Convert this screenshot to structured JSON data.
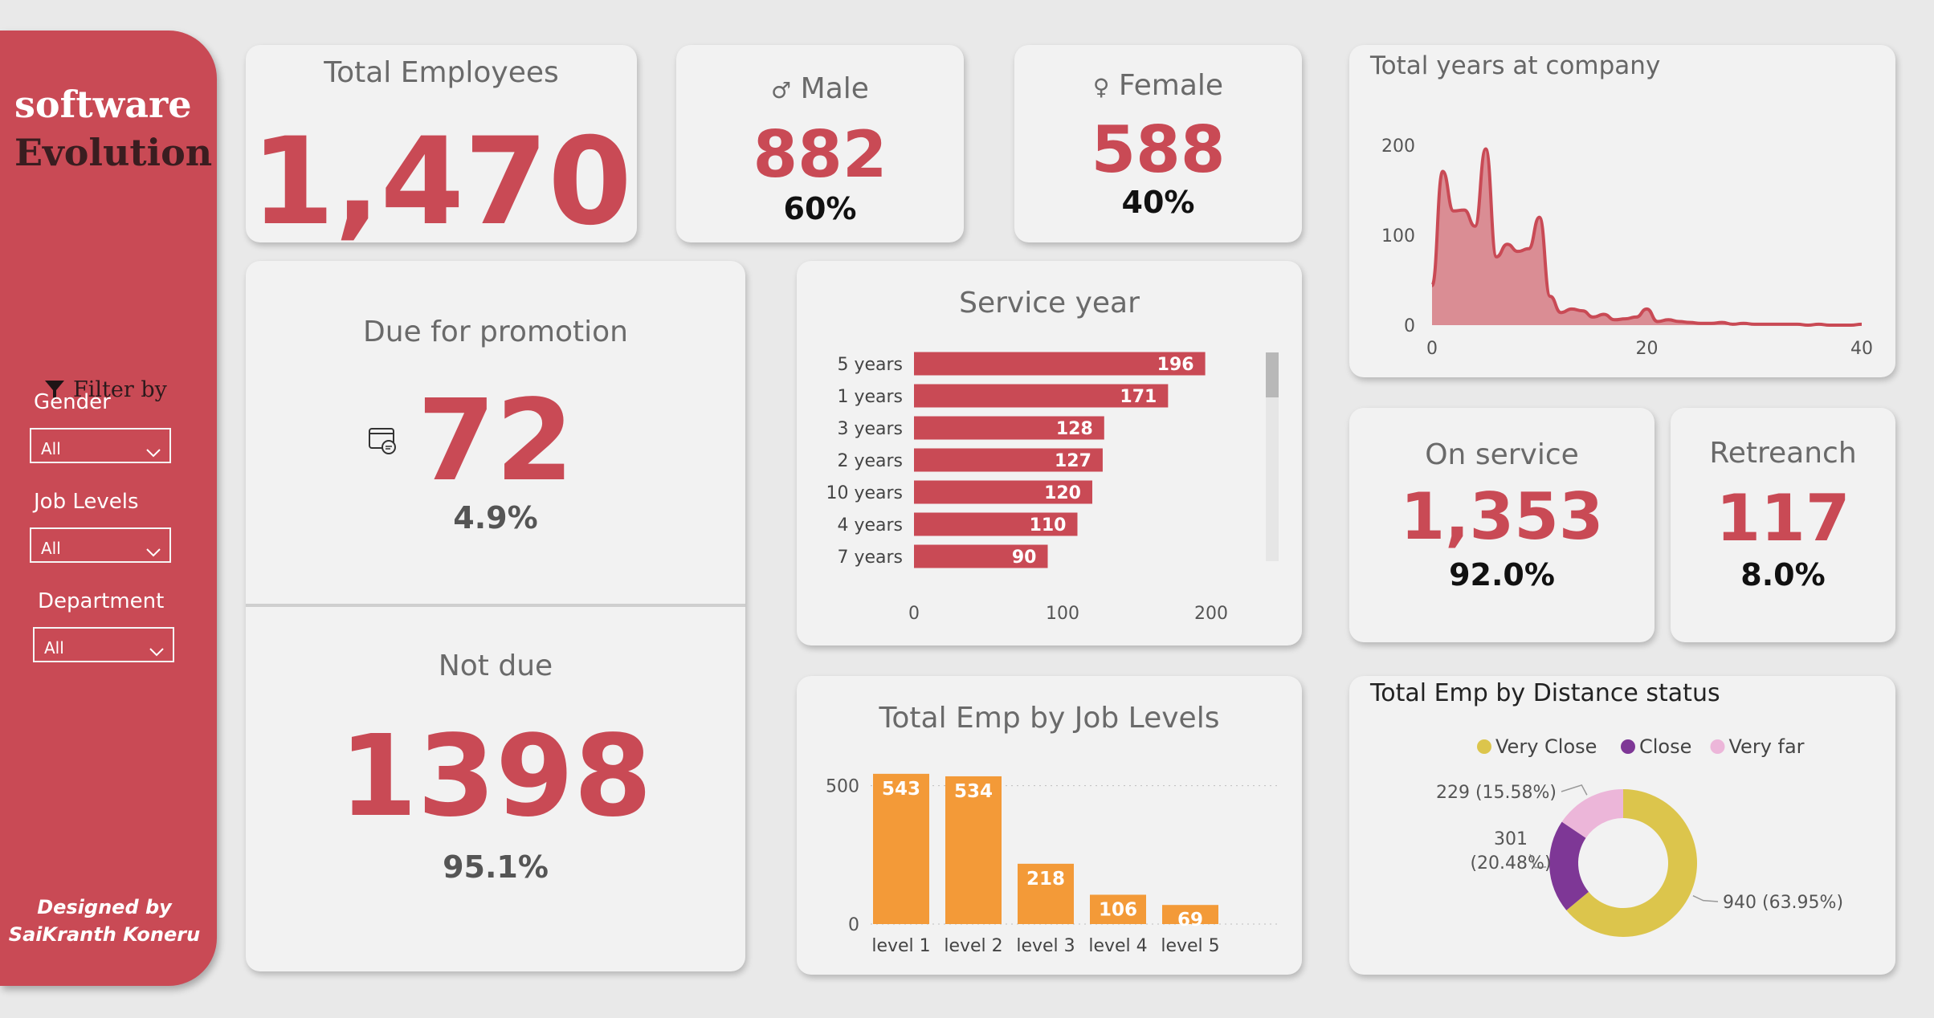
{
  "sidebar": {
    "brand_line1": "software",
    "brand_line2": "Evolution",
    "filter_by": "Filter by",
    "filters": [
      {
        "label": "Gender",
        "value": "All"
      },
      {
        "label": "Job Levels",
        "value": "All"
      },
      {
        "label": "Department",
        "value": "All"
      }
    ],
    "credit_line1": "Designed by",
    "credit_line2": "SaiKranth Koneru"
  },
  "kpis": {
    "total_employees": {
      "title": "Total Employees",
      "value": "1,470"
    },
    "male": {
      "title": "Male",
      "value": "882",
      "pct": "60%"
    },
    "female": {
      "title": "Female",
      "value": "588",
      "pct": "40%"
    },
    "due": {
      "title": "Due for promotion",
      "value": "72",
      "pct": "4.9%"
    },
    "not_due": {
      "title": "Not due",
      "value": "1398",
      "pct": "95.1%"
    },
    "on_service": {
      "title": "On service",
      "value": "1,353",
      "pct": "92.0%"
    },
    "retrench": {
      "title": "Retreanch",
      "value": "117",
      "pct": "8.0%"
    }
  },
  "colors": {
    "accent": "#c94a55",
    "orange": "#f39a38",
    "very_close": "#dcc54c",
    "close": "#7e3796",
    "very_far": "#ecb6d9"
  },
  "chart_data": [
    {
      "type": "area",
      "title": "Total years at company",
      "x": [
        0,
        1,
        2,
        3,
        4,
        5,
        6,
        7,
        8,
        9,
        10,
        11,
        12,
        13,
        14,
        15,
        16,
        17,
        18,
        19,
        20,
        21,
        22,
        23,
        24,
        25,
        26,
        27,
        28,
        29,
        30,
        31,
        32,
        33,
        34,
        35,
        36,
        37,
        38,
        39,
        40
      ],
      "values": [
        44,
        171,
        127,
        128,
        110,
        196,
        76,
        90,
        82,
        85,
        120,
        32,
        14,
        18,
        16,
        9,
        12,
        6,
        7,
        9,
        18,
        4,
        6,
        4,
        3,
        2,
        2,
        3,
        1,
        2,
        1,
        1,
        1,
        1,
        1,
        0,
        1,
        0,
        0,
        0,
        1
      ],
      "ylim": [
        0,
        200
      ],
      "yticks": [
        0,
        100,
        200
      ],
      "xlim": [
        0,
        40
      ],
      "xticks": [
        0,
        20,
        40
      ]
    },
    {
      "type": "bar",
      "orientation": "horizontal",
      "title": "Service year",
      "categories": [
        "5 years",
        "1 years",
        "3 years",
        "2 years",
        "10 years",
        "4 years",
        "7 years"
      ],
      "values": [
        196,
        171,
        128,
        127,
        120,
        110,
        90
      ],
      "xlim": [
        0,
        200
      ],
      "xticks": [
        0,
        100,
        200
      ]
    },
    {
      "type": "bar",
      "title": "Total Emp by Job Levels",
      "categories": [
        "level 1",
        "level 2",
        "level 3",
        "level 4",
        "level 5"
      ],
      "values": [
        543,
        534,
        218,
        106,
        69
      ],
      "ylim": [
        0,
        560
      ],
      "yticks": [
        0,
        500
      ]
    },
    {
      "type": "pie",
      "donut": true,
      "title": "Total Emp by Distance status",
      "legend": "top",
      "series": [
        {
          "name": "Very Close",
          "value": 940,
          "label": "940 (63.95%)"
        },
        {
          "name": "Close",
          "value": 301,
          "label": "301 (20.48%)"
        },
        {
          "name": "Very far",
          "value": 229,
          "label": "229 (15.58%)"
        }
      ]
    }
  ]
}
